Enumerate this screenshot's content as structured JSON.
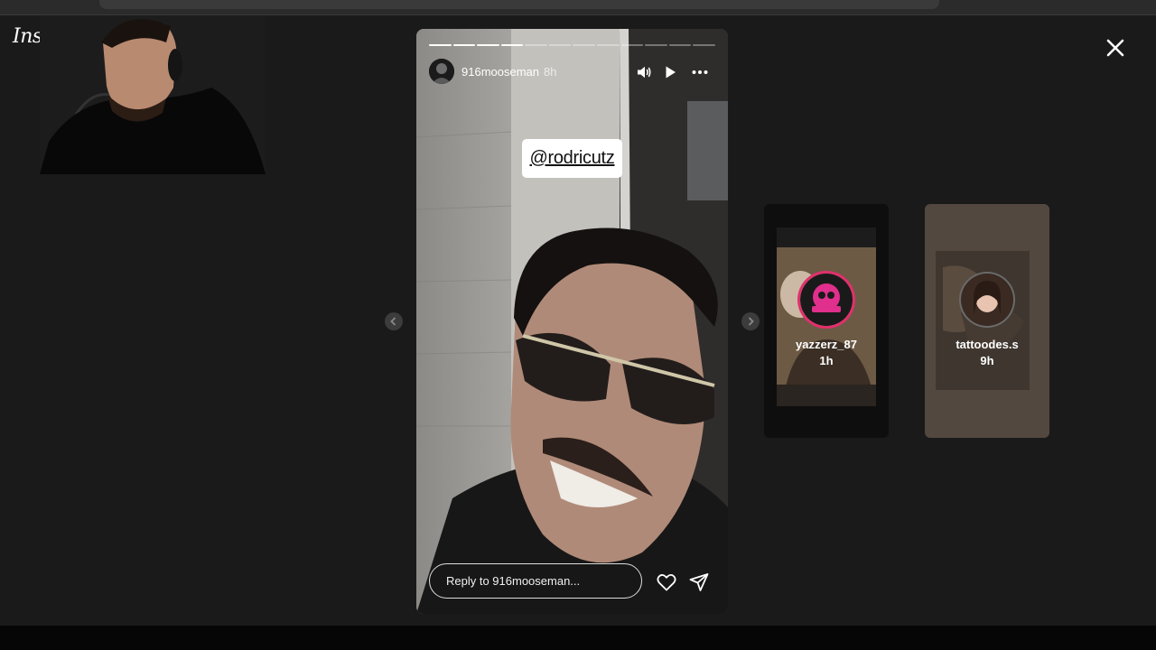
{
  "app": {
    "logo_text": "Instagram"
  },
  "story": {
    "username": "916mooseman",
    "time_ago": "8h",
    "progress": {
      "segments": 12,
      "completed": 4
    },
    "mention_sticker": "@rodricutz",
    "reply_placeholder": "Reply to 916mooseman...",
    "controls": [
      "volume-icon",
      "play-icon",
      "more-options-icon"
    ]
  },
  "up_next": [
    {
      "username": "yazzerz_87",
      "time_ago": "1h",
      "ring_color": "#e1306c"
    },
    {
      "username": "tattoodes.s",
      "time_ago": "9h"
    }
  ],
  "icons": {
    "close": "close-icon",
    "prev": "chevron-left-icon",
    "next": "chevron-right-icon",
    "like": "heart-icon",
    "share": "send-icon"
  },
  "colors": {
    "background": "#1a1a1a",
    "text": "#ffffff"
  }
}
